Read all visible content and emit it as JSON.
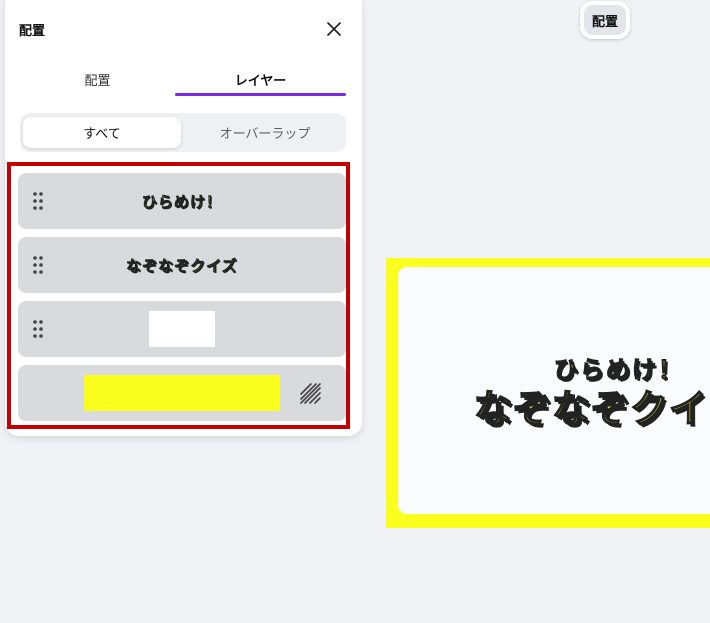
{
  "panel": {
    "title": "配置",
    "close_icon": "close-icon",
    "tabs": [
      {
        "label": "配置",
        "active": false
      },
      {
        "label": "レイヤー",
        "active": true
      }
    ],
    "filter": [
      {
        "label": "すべて",
        "active": true
      },
      {
        "label": "オーバーラップ",
        "active": false
      }
    ],
    "layers": [
      {
        "type": "text",
        "label": "ひらめけ！",
        "icon": "drag-handle-icon"
      },
      {
        "type": "text",
        "label": "なぞなぞクイズ",
        "icon": "drag-handle-icon"
      },
      {
        "type": "shape",
        "thumb_color": "#ffffff",
        "icon": "drag-handle-icon"
      },
      {
        "type": "background",
        "thumb_color": "#fbff1d",
        "icon": "locked-hatch-icon"
      }
    ]
  },
  "canvas": {
    "chip_label": "配置",
    "subtitle": "ひらめけ！",
    "title": "なぞなぞクイ"
  },
  "colors": {
    "accent": "#7d2ae8",
    "highlight_border": "#c50000",
    "yellow": "#fbff1d"
  }
}
